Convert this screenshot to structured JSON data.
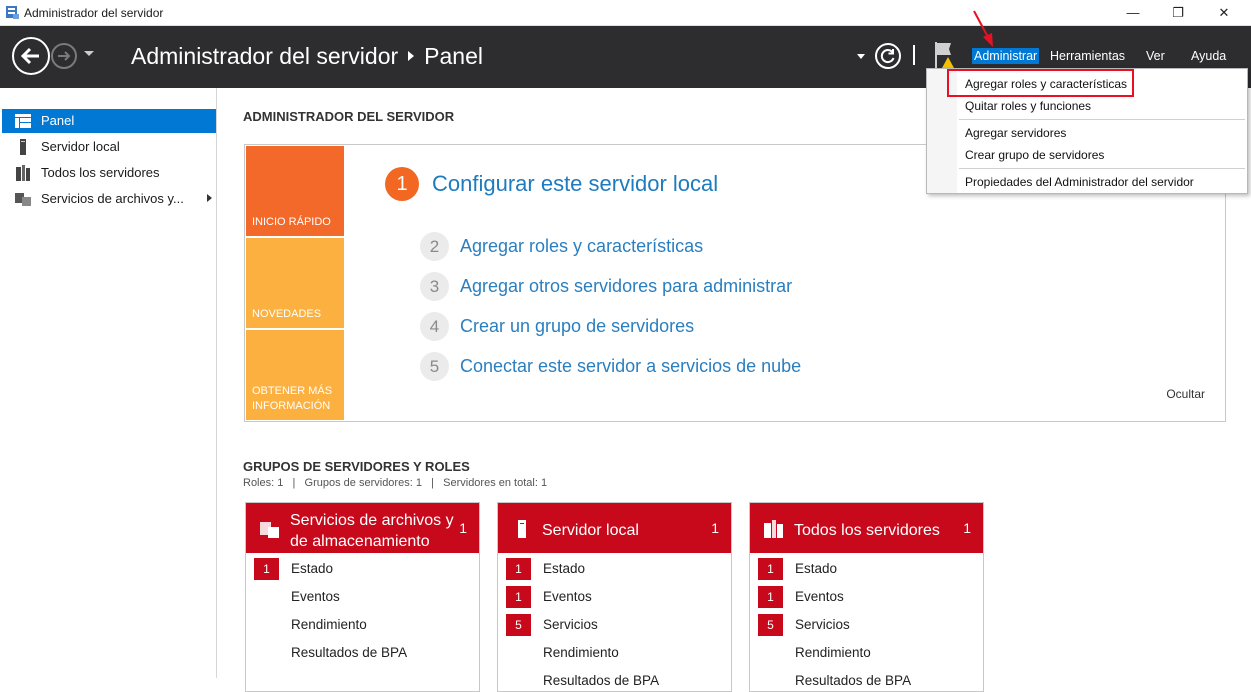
{
  "window": {
    "title": "Administrador del servidor",
    "minimize": "—",
    "restore": "❐",
    "close": "✕"
  },
  "header": {
    "app_name": "Administrador del servidor",
    "page": "Panel",
    "menus": [
      "Administrar",
      "Herramientas",
      "Ver",
      "Ayuda"
    ]
  },
  "sidebar": {
    "items": [
      {
        "label": "Panel",
        "icon": "dashboard-icon",
        "selected": true
      },
      {
        "label": "Servidor local",
        "icon": "server-icon"
      },
      {
        "label": "Todos los servidores",
        "icon": "servers-icon"
      },
      {
        "label": "Servicios de archivos y...",
        "icon": "file-services-icon"
      }
    ]
  },
  "main": {
    "title": "ADMINISTRADOR DEL SERVIDOR",
    "quick_start": {
      "tiles": [
        "INICIO RÁPIDO",
        "NOVEDADES",
        "OBTENER MÁS INFORMACIÓN"
      ],
      "main_step": {
        "num": "1",
        "label": "Configurar este servidor local"
      },
      "steps": [
        {
          "num": "2",
          "label": "Agregar roles y características"
        },
        {
          "num": "3",
          "label": "Agregar otros servidores para administrar"
        },
        {
          "num": "4",
          "label": "Crear un grupo de servidores"
        },
        {
          "num": "5",
          "label": "Conectar este servidor a servicios de nube"
        }
      ],
      "hide": "Ocultar"
    },
    "groups": {
      "title": "GRUPOS DE SERVIDORES Y ROLES",
      "summary": "Roles: 1   |   Grupos de servidores: 1   |   Servidores en total: 1",
      "cards": [
        {
          "title": "Servicios de archivos y de almacenamiento",
          "count": "1",
          "rows": [
            {
              "badge": "1",
              "label": "Estado"
            },
            {
              "badge": "",
              "label": "Eventos"
            },
            {
              "badge": "",
              "label": "Rendimiento"
            },
            {
              "badge": "",
              "label": "Resultados de BPA"
            }
          ]
        },
        {
          "title": "Servidor local",
          "count": "1",
          "rows": [
            {
              "badge": "1",
              "label": "Estado"
            },
            {
              "badge": "1",
              "label": "Eventos"
            },
            {
              "badge": "5",
              "label": "Servicios"
            },
            {
              "badge": "",
              "label": "Rendimiento"
            },
            {
              "badge": "",
              "label": "Resultados de BPA"
            }
          ]
        },
        {
          "title": "Todos los servidores",
          "count": "1",
          "rows": [
            {
              "badge": "1",
              "label": "Estado"
            },
            {
              "badge": "1",
              "label": "Eventos"
            },
            {
              "badge": "5",
              "label": "Servicios"
            },
            {
              "badge": "",
              "label": "Rendimiento"
            },
            {
              "badge": "",
              "label": "Resultados de BPA"
            }
          ]
        }
      ]
    }
  },
  "dropdown": {
    "items": [
      "Agregar roles y características",
      "Quitar roles y funciones",
      "Agregar servidores",
      "Crear grupo de servidores",
      "Propiedades del Administrador del servidor"
    ]
  },
  "colors": {
    "header_bg": "#2d2d30",
    "accent_blue": "#0078d4",
    "orange": "#f3692a",
    "light_orange": "#fcb03f",
    "role_red": "#c8081b",
    "link_blue": "#2a7fc0",
    "annotation_red": "#e81123"
  }
}
